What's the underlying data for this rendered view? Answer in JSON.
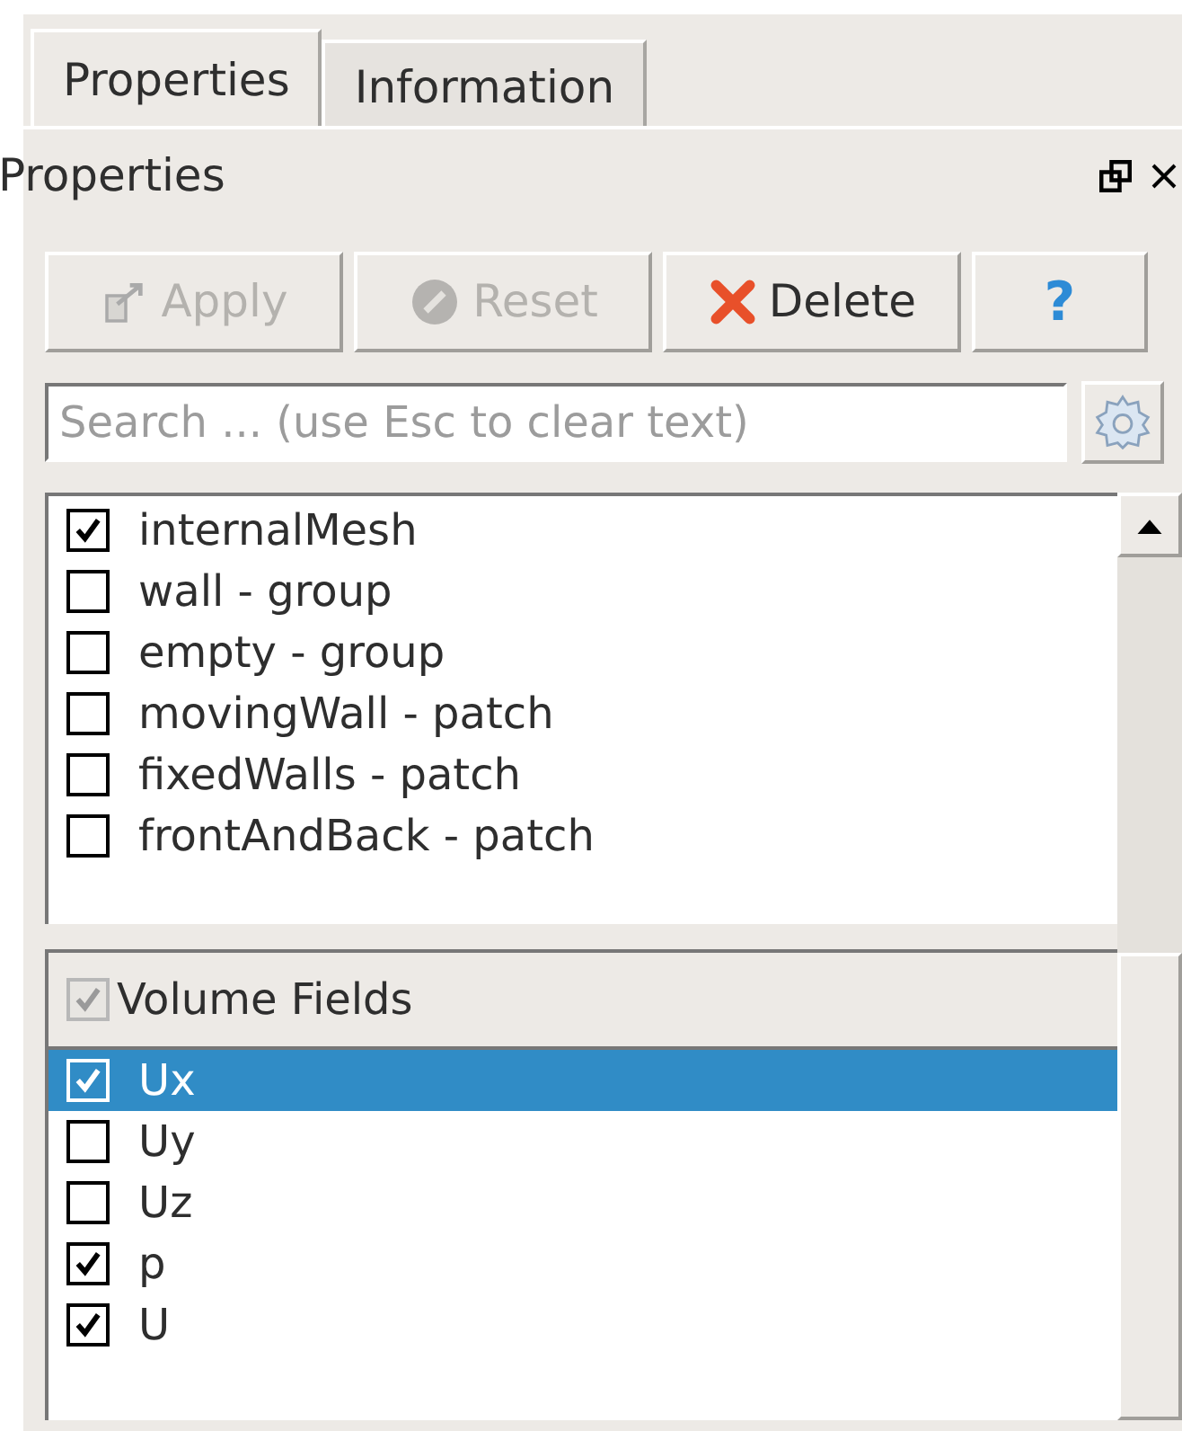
{
  "tabs": [
    {
      "label": "Properties",
      "selected": true
    },
    {
      "label": "Information",
      "selected": false
    }
  ],
  "panel": {
    "title": "Properties"
  },
  "buttons": [
    {
      "kind": "apply",
      "label": "Apply",
      "disabled": true
    },
    {
      "kind": "reset",
      "label": "Reset",
      "disabled": true
    },
    {
      "kind": "delete",
      "label": "Delete",
      "disabled": false
    },
    {
      "kind": "help",
      "label": "?",
      "disabled": false
    }
  ],
  "search": {
    "placeholder": "Search ... (use Esc to clear text)"
  },
  "blocks": [
    {
      "name": "internalMesh",
      "checked": true
    },
    {
      "name": "wall - group",
      "checked": false
    },
    {
      "name": "empty - group",
      "checked": false
    },
    {
      "name": "movingWall - patch",
      "checked": false
    },
    {
      "name": "fixedWalls - patch",
      "checked": false
    },
    {
      "name": "frontAndBack - patch",
      "checked": false
    }
  ],
  "volume_fields": {
    "header": "Volume Fields",
    "checked": true,
    "items": [
      {
        "name": "Ux",
        "checked": true,
        "selected": true
      },
      {
        "name": "Uy",
        "checked": false,
        "selected": false
      },
      {
        "name": "Uz",
        "checked": false,
        "selected": false
      },
      {
        "name": "p",
        "checked": true,
        "selected": false
      },
      {
        "name": "U",
        "checked": true,
        "selected": false
      }
    ]
  }
}
